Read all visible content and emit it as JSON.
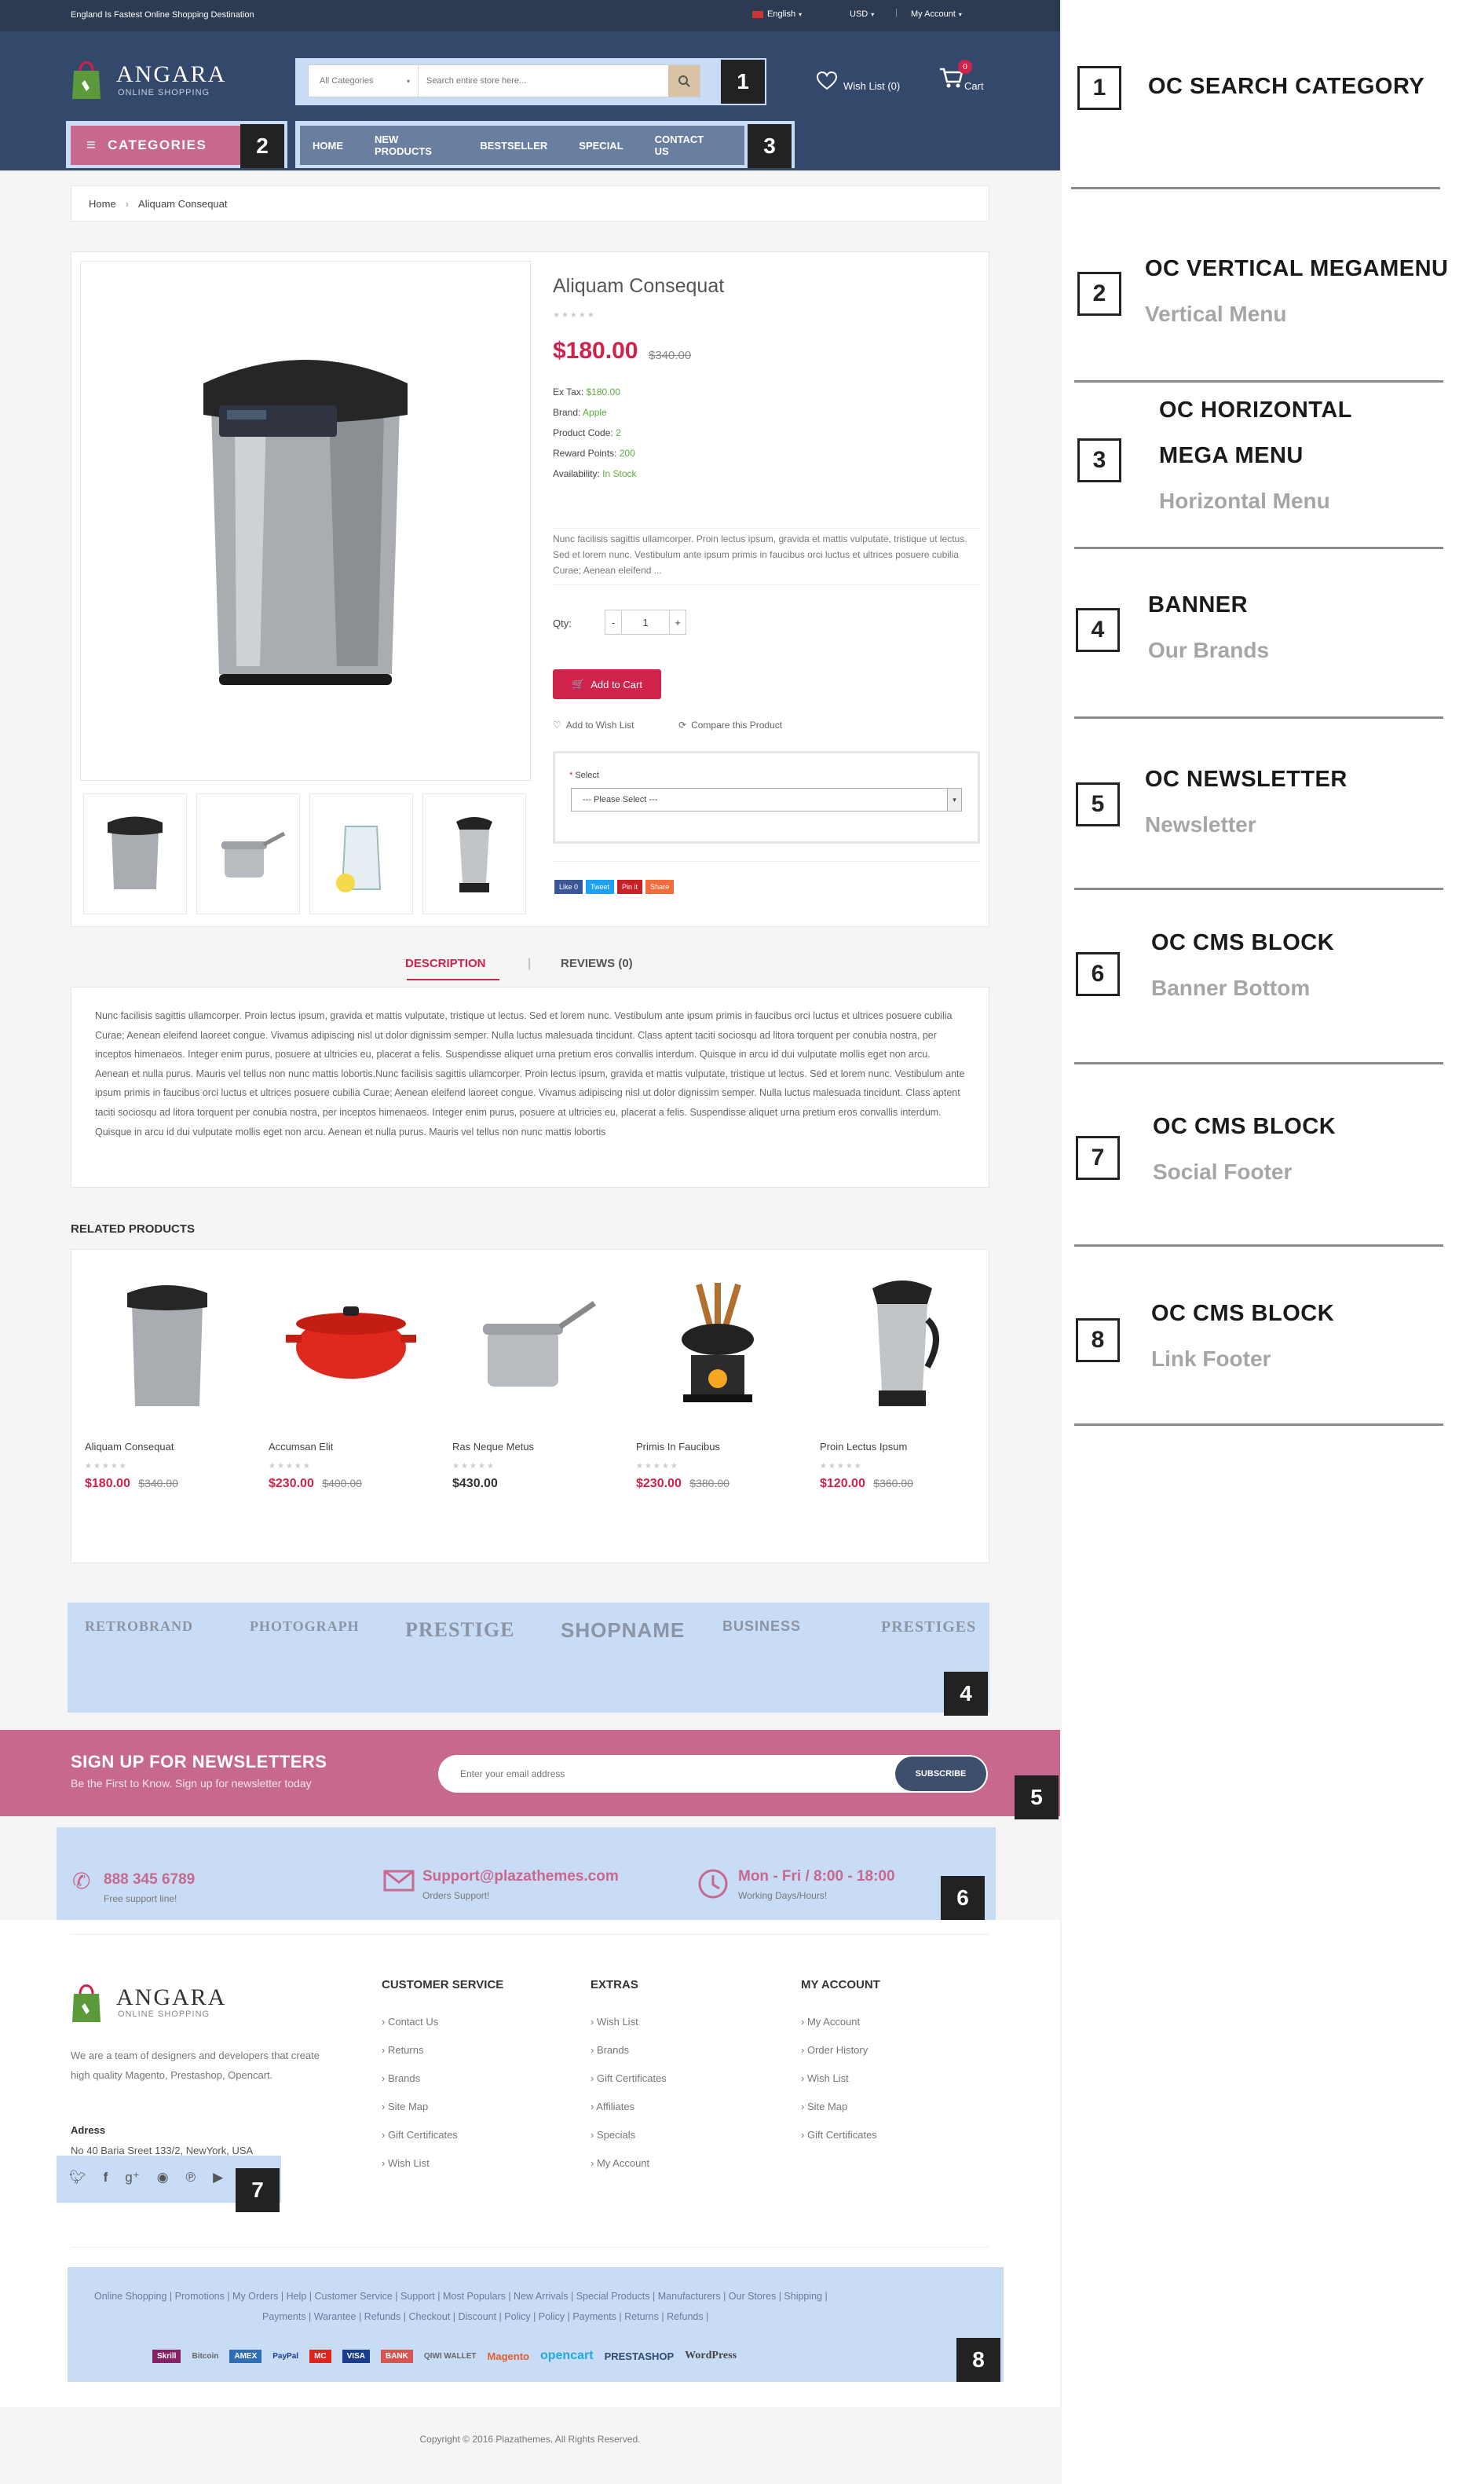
{
  "topbar": {
    "tagline": "England Is Fastest Online Shopping Destination",
    "language": "English",
    "currency": "USD",
    "account": "My Account"
  },
  "header": {
    "logo_name": "ANGARA",
    "logo_sub": "ONLINE SHOPPING",
    "search_category": "All Categories",
    "search_placeholder": "Search entire store here...",
    "wishlist": "Wish List (0)",
    "cart": "Cart",
    "cart_count": "0",
    "categories": "CATEGORIES",
    "nav": [
      "HOME",
      "NEW PRODUCTS",
      "BESTSELLER",
      "SPECIAL",
      "CONTACT US"
    ]
  },
  "breadcrumb": {
    "home": "Home",
    "current": "Aliquam Consequat"
  },
  "product": {
    "name": "Aliquam Consequat",
    "price": "$180.00",
    "old_price": "$340.00",
    "ex_tax_label": "Ex Tax:",
    "ex_tax": "$180.00",
    "brand_label": "Brand:",
    "brand": "Apple",
    "code_label": "Product Code:",
    "code": "2",
    "points_label": "Reward Points:",
    "points": "200",
    "avail_label": "Availability:",
    "avail": "In Stock",
    "short_desc": "Nunc facilisis sagittis ullamcorper. Proin lectus ipsum, gravida et mattis vulputate, tristique ut lectus. Sed et lorem nunc. Vestibulum ante ipsum primis in faucibus orci luctus et ultrices posuere cubilia Curae; Aenean eleifend ...",
    "qty_label": "Qty:",
    "qty": "1",
    "add_to_cart": "Add to Cart",
    "add_wishlist": "Add to Wish List",
    "compare": "Compare this Product",
    "select_label": "Select",
    "select_value": "--- Please Select ---",
    "share": [
      "Like 0",
      "Tweet",
      "Pin it",
      "Share"
    ]
  },
  "tabs": {
    "description": "DESCRIPTION",
    "reviews": "REVIEWS (0)"
  },
  "description": "Nunc facilisis sagittis ullamcorper. Proin lectus ipsum, gravida et mattis vulputate, tristique ut lectus. Sed et lorem nunc. Vestibulum ante ipsum primis in faucibus orci luctus et ultrices posuere cubilia Curae; Aenean eleifend laoreet congue. Vivamus adipiscing nisl ut dolor dignissim semper. Nulla luctus malesuada tincidunt. Class aptent taciti sociosqu ad litora torquent per conubia nostra, per inceptos himenaeos. Integer enim purus, posuere at ultricies eu, placerat a felis. Suspendisse aliquet urna pretium eros convallis interdum. Quisque in arcu id dui vulputate mollis eget non arcu. Aenean et nulla purus. Mauris vel tellus non nunc mattis lobortis.Nunc facilisis sagittis ullamcorper. Proin lectus ipsum, gravida et mattis vulputate, tristique ut lectus. Sed et lorem nunc. Vestibulum ante ipsum primis in faucibus orci luctus et ultrices posuere cubilia Curae; Aenean eleifend laoreet congue. Vivamus adipiscing nisl ut dolor dignissim semper. Nulla luctus malesuada tincidunt. Class aptent taciti sociosqu ad litora torquent per conubia nostra, per inceptos himenaeos. Integer enim purus, posuere at ultricies eu, placerat a felis. Suspendisse aliquet urna pretium eros convallis interdum. Quisque in arcu id dui vulputate mollis eget non arcu. Aenean et nulla purus. Mauris vel tellus non nunc mattis lobortis",
  "related": {
    "title": "RELATED PRODUCTS",
    "items": [
      {
        "name": "Aliquam Consequat",
        "price": "$180.00",
        "old": "$340.00"
      },
      {
        "name": "Accumsan Elit",
        "price": "$230.00",
        "old": "$400.00"
      },
      {
        "name": "Ras Neque Metus",
        "price": "$430.00",
        "old": ""
      },
      {
        "name": "Primis In Faucibus",
        "price": "$230.00",
        "old": "$380.00"
      },
      {
        "name": "Proin Lectus Ipsum",
        "price": "$120.00",
        "old": "$360.00"
      }
    ]
  },
  "brands": [
    "RETROBRAND",
    "PHOTOGRAPH",
    "PRESTIGE",
    "SHOPNAME",
    "BUSINESS",
    "PRESTIGES"
  ],
  "newsletter": {
    "title": "SIGN UP FOR NEWSLETTERS",
    "subtitle": "Be the First to Know. Sign up for newsletter today",
    "placeholder": "Enter your email address",
    "button": "SUBSCRIBE"
  },
  "contact": {
    "phone": "888 345 6789",
    "phone_sub": "Free support line!",
    "email": "Support@plazathemes.com",
    "email_sub": "Orders Support!",
    "hours": "Mon - Fri / 8:00 - 18:00",
    "hours_sub": "Working Days/Hours!"
  },
  "footer": {
    "about": "We are a team of designers and developers that create high quality Magento, Prestashop, Opencart.",
    "address_label": "Adress",
    "address": "No 40 Baria Sreet 133/2, NewYork, USA",
    "cols": [
      {
        "title": "CUSTOMER SERVICE",
        "links": [
          "Contact Us",
          "Returns",
          "Brands",
          "Site Map",
          "Gift Certificates",
          "Wish List"
        ]
      },
      {
        "title": "EXTRAS",
        "links": [
          "Wish List",
          "Brands",
          "Gift Certificates",
          "Affiliates",
          "Specials",
          "My Account"
        ]
      },
      {
        "title": "MY ACCOUNT",
        "links": [
          "My Account",
          "Order History",
          "Wish List",
          "Site Map",
          "Gift Certificates"
        ]
      }
    ],
    "links_line1": "Online Shopping | Promotions | My Orders | Help | Customer Service | Support | Most Populars | New Arrivals | Special Products | Manufacturers | Our Stores | Shipping |",
    "links_line2": "Payments | Warantee | Refunds | Checkout | Discount | Policy | Policy | Payments | Returns | Refunds |",
    "payments": [
      "Skrill",
      "Bitcoin",
      "AMEX",
      "PayPal",
      "MC",
      "VISA",
      "BANK",
      "QIWI WALLET",
      "Magento",
      "opencart",
      "PRESTASHOP",
      "WordPress"
    ],
    "copyright": "Copyright © 2016 Plazathemes. All Rights Reserved."
  },
  "annotations": [
    {
      "num": "1",
      "title": "OC SEARCH CATEGORY",
      "title2": "",
      "sub": ""
    },
    {
      "num": "2",
      "title": "OC VERTICAL MEGAMENU",
      "title2": "",
      "sub": "Vertical Menu"
    },
    {
      "num": "3",
      "title": "OC HORIZONTAL",
      "title2": "MEGA MENU",
      "sub": "Horizontal Menu"
    },
    {
      "num": "4",
      "title": "BANNER",
      "title2": "",
      "sub": "Our Brands"
    },
    {
      "num": "5",
      "title": "OC NEWSLETTER",
      "title2": "",
      "sub": "Newsletter"
    },
    {
      "num": "6",
      "title": "OC CMS BLOCK",
      "title2": "",
      "sub": "Banner Bottom"
    },
    {
      "num": "7",
      "title": "OC CMS BLOCK",
      "title2": "",
      "sub": "Social Footer"
    },
    {
      "num": "8",
      "title": "OC CMS BLOCK",
      "title2": "",
      "sub": "Link Footer"
    }
  ],
  "colors": {
    "accent": "#d0224a",
    "header": "#34486b",
    "newsletter": "#c7698f",
    "highlight": "#c9dcf5"
  }
}
